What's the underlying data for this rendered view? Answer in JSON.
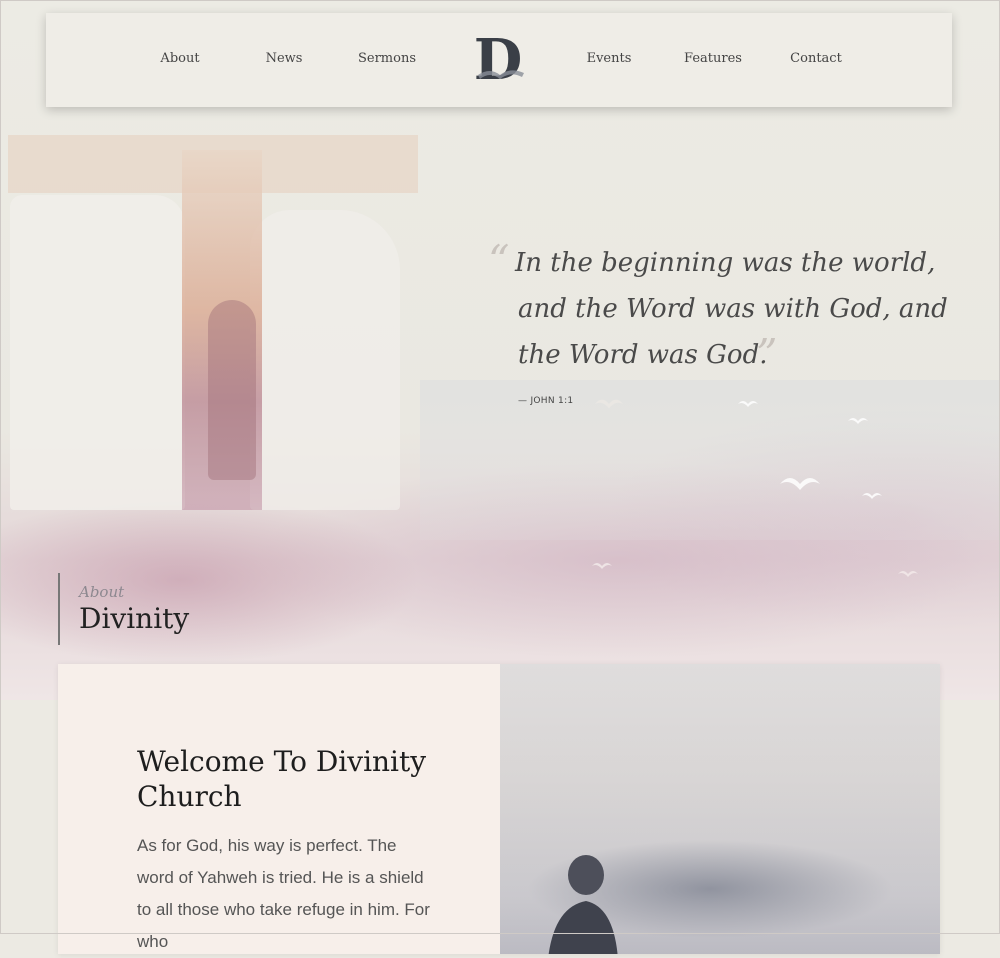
{
  "nav": {
    "items_left": [
      "About",
      "News",
      "Sermons"
    ],
    "logo_letter": "D",
    "items_right": [
      "Events",
      "Features",
      "Contact"
    ]
  },
  "quote": {
    "lines": [
      "In the beginning was the world,",
      "and the Word was with God, and",
      "the Word was God."
    ],
    "citation": "— JOHN 1:1"
  },
  "about": {
    "kicker": "About",
    "title": "Divinity"
  },
  "welcome": {
    "title": "Welcome To Divinity Church",
    "body": "As for God, his way is perfect. The word of Yahweh is tried. He is a shield to all those who take refuge in him. For who"
  },
  "colors": {
    "background": "#eceae3",
    "nav_background": "#efede7",
    "card_background": "#f7efea",
    "accent_pink": "#c89aa8",
    "text_dark": "#222222"
  }
}
